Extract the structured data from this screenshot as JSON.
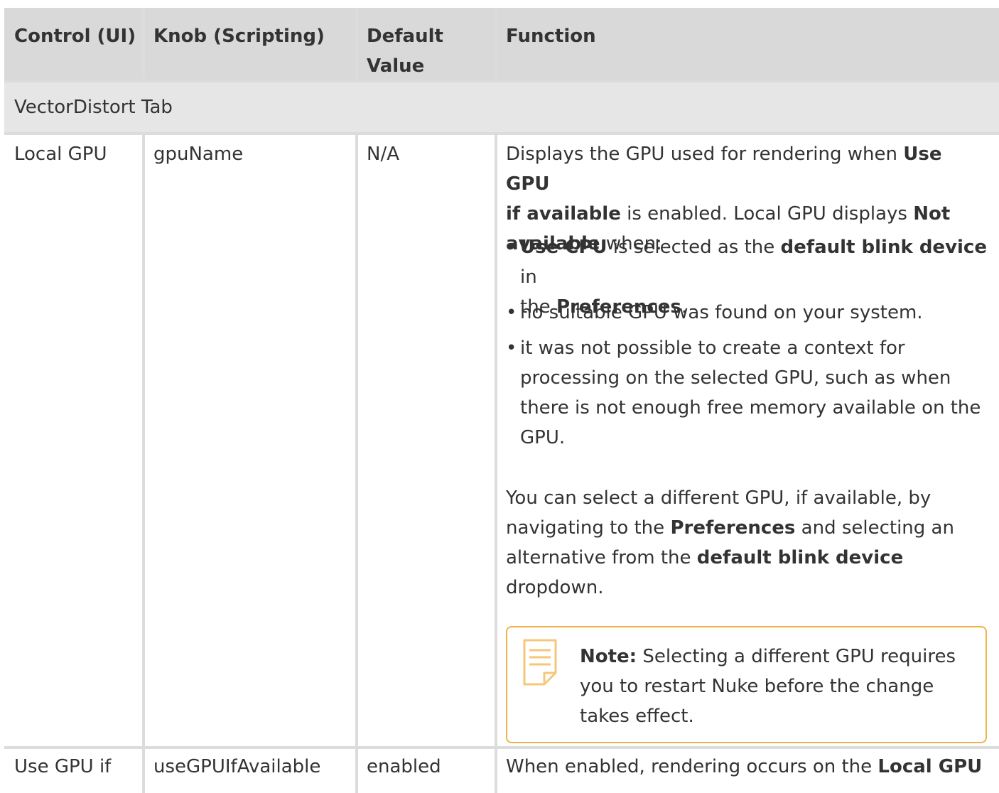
{
  "header": {
    "col1": "Control (UI)",
    "col2": "Knob (Scripting)",
    "col3_line1": "Default",
    "col3_line2": "Value",
    "col4": "Function"
  },
  "section": {
    "label": "VectorDistort Tab"
  },
  "row1": {
    "control": "Local GPU",
    "knob": "gpuName",
    "default": "N/A",
    "fn_l1_a": "Displays the GPU used for rendering when ",
    "fn_l1_b": "Use GPU",
    "fn_l2_a": "if available",
    "fn_l2_b": " is enabled. Local GPU displays ",
    "fn_l2_c": "Not",
    "fn_l3_a": "available",
    "fn_l3_b": " when:",
    "b1_a": "Use CPU",
    "b1_b": " is selected as the ",
    "b1_c": "default blink device",
    "b1_d": " in",
    "b1_l2_a": "the ",
    "b1_l2_b": "Preferences",
    "b1_l2_c": ".",
    "b2": "no suitable GPU was found on your system.",
    "b3_l1": "it was not possible to create a context for",
    "b3_l2": "processing on the selected GPU, such as when",
    "b3_l3": "there is not enough free memory available on the",
    "b3_l4": "GPU.",
    "p2_l1": "You can select a different GPU, if available, by",
    "p2_l2_a": "navigating to the ",
    "p2_l2_b": "Preferences",
    "p2_l2_c": " and selecting an",
    "p2_l3_a": "alternative from the ",
    "p2_l3_b": "default blink device",
    "p2_l4": "dropdown.",
    "bullet_char": "•",
    "note": {
      "label": "Note:",
      "l1": " Selecting a different GPU requires",
      "l2": "you to restart Nuke before the change",
      "l3": "takes effect.",
      "icon": "note-icon",
      "border_color": "#f2b24a"
    }
  },
  "row2": {
    "control": "Use GPU if",
    "knob": "useGPUIfAvailable",
    "default": "enabled",
    "fn_a": "When enabled, rendering occurs on the ",
    "fn_b": "Local GPU"
  }
}
